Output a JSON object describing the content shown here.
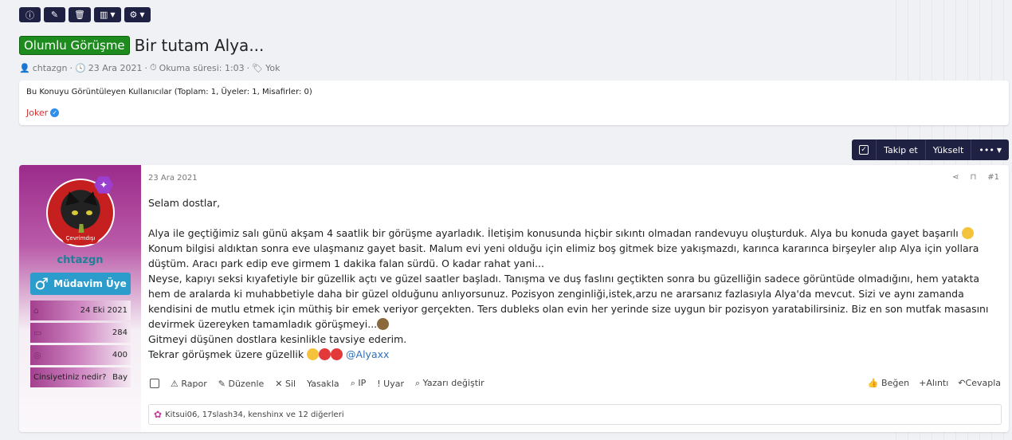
{
  "toolbar": {
    "info_icon": "info-icon",
    "edit_icon": "edit-icon",
    "delete_icon": "trash-icon",
    "stats_icon": "chart-icon",
    "settings_icon": "gear-icon"
  },
  "thread": {
    "prefix": "Olumlu Görüşme",
    "title": "Bir tutam Alya...",
    "author": "chtazgn",
    "date": "23 Ara 2021",
    "read_time": "Okuma süresi: 1:03",
    "tags": "Yok"
  },
  "viewers": {
    "heading": "Bu Konuyu Görüntüleyen Kullanıcılar (Toplam: 1, Üyeler: 1, Misafirler: 0)",
    "user": "Joker"
  },
  "actions": {
    "follow": "Takip et",
    "bump": "Yükselt"
  },
  "post": {
    "date": "23 Ara 2021",
    "number": "#1",
    "user": {
      "name": "chtazgn",
      "status": "Çevrimdışı",
      "rank": "Müdavim Üye",
      "join_date": "24 Eki 2021",
      "messages": "284",
      "points": "400",
      "gender_label": "Cinsiyetiniz nedir?",
      "gender_value": "Bay"
    },
    "body": {
      "greeting": "Selam dostlar,",
      "p1": "Alya ile geçtiğimiz salı günü akşam 4 saatlik bir görüşme ayarladık. İletişim konusunda hiçbir sıkıntı olmadan randevuyu oluşturduk. Alya bu konuda gayet başarılı",
      "p2": "Konum bilgisi aldıktan sonra eve ulaşmanız gayet basit. Malum evi yeni olduğu için elimiz boş gitmek bize yakışmazdı, karınca kararınca birşeyler alıp Alya için yollara düştüm. Aracı park edip eve girmem 1 dakika falan sürdü. O kadar rahat yani...",
      "p3": "Neyse, kapıyı seksi kıyafetiyle bir güzellik açtı ve güzel saatler başladı. Tanışma ve duş faslını geçtikten sonra bu güzelliğin sadece görüntüde olmadığını, hem yatakta hem de aralarda ki muhabbetiyle daha bir güzel olduğunu anlıyorsunuz. Pozisyon zenginliği,istek,arzu ne ararsanız fazlasıyla Alya'da mevcut. Sizi ve aynı zamanda kendisini de mutlu etmek için müthiş bir emek veriyor gerçekten. Ters dubleks olan evin her yerinde size uygun bir pozisyon yaratabilirsiniz. Biz en son mutfak masasını devirmek üzereyken tamamladık görüşmeyi...",
      "p4": "Gitmeyi düşünen dostlara kesinlikle tavsiye ederim.",
      "p5": "Tekrar görüşmek üzere güzellik",
      "mention": "@Alyaxx"
    },
    "actions_left": [
      "Rapor",
      "Düzenle",
      "Sil",
      "Yasakla",
      "IP",
      "Uyar",
      "Yazarı değiştir"
    ],
    "actions_right": [
      "Beğen",
      "Alıntı",
      "Cevapla"
    ],
    "reactions": "Kitsui06, 17slash34, kenshinx ve 12 diğerleri"
  }
}
